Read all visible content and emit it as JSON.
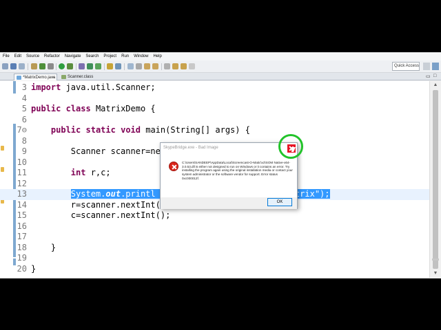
{
  "menu": [
    "File",
    "Edit",
    "Source",
    "Refactor",
    "Navigate",
    "Search",
    "Project",
    "Run",
    "Window",
    "Help"
  ],
  "toolbar": {
    "quick_access_label": "Quick Access"
  },
  "tabs": [
    {
      "label": "*MatrixDemo.java",
      "active": true
    },
    {
      "label": "Scanner.class",
      "active": false
    }
  ],
  "editor": {
    "lines": [
      {
        "n": "3",
        "segments": [
          {
            "t": "import",
            "c": "kw"
          },
          {
            "t": " java.util.Scanner;"
          }
        ]
      },
      {
        "n": "4",
        "segments": []
      },
      {
        "n": "5",
        "segments": [
          {
            "t": "public",
            "c": "kw"
          },
          {
            "t": " "
          },
          {
            "t": "class",
            "c": "kw"
          },
          {
            "t": " MatrixDemo {"
          }
        ]
      },
      {
        "n": "6",
        "segments": []
      },
      {
        "n": "7⊖",
        "segments": [
          {
            "t": "    "
          },
          {
            "t": "public",
            "c": "kw"
          },
          {
            "t": " "
          },
          {
            "t": "static",
            "c": "kw"
          },
          {
            "t": " "
          },
          {
            "t": "void",
            "c": "kw"
          },
          {
            "t": " main(String[] args) {"
          }
        ]
      },
      {
        "n": "8",
        "segments": []
      },
      {
        "n": "9",
        "segments": [
          {
            "t": "        Scanner scanner=new"
          }
        ]
      },
      {
        "n": "10",
        "segments": []
      },
      {
        "n": "11",
        "segments": [
          {
            "t": "        "
          },
          {
            "t": "int",
            "c": "kw"
          },
          {
            "t": " r,c;"
          }
        ]
      },
      {
        "n": "12",
        "segments": []
      },
      {
        "n": "13",
        "segments": [
          {
            "t": "        "
          },
          {
            "t": "System.",
            "c": "sel"
          },
          {
            "t": "out",
            "c": "sel it"
          },
          {
            "t": ".printl",
            "c": "sel"
          },
          {
            "t": "                        ",
            "c": "sel"
          },
          {
            "t": "n matrix\");",
            "c": "sel"
          }
        ]
      },
      {
        "n": "14",
        "segments": [
          {
            "t": "        r=scanner.nextInt("
          }
        ]
      },
      {
        "n": "15",
        "segments": [
          {
            "t": "        c=scanner.nextInt();"
          }
        ]
      },
      {
        "n": "16",
        "segments": []
      },
      {
        "n": "17",
        "segments": []
      },
      {
        "n": "18",
        "segments": [
          {
            "t": "    }"
          }
        ]
      },
      {
        "n": "19",
        "segments": []
      },
      {
        "n": "20",
        "segments": [
          {
            "t": "}"
          }
        ]
      }
    ]
  },
  "dialog": {
    "title": "SkypeBridge.exe - Bad Image",
    "message": "C:\\Users\\SANDEEP\\AppData\\Local\\Screencast-O-Matic\\v2\\SOM Native-x64-3.0.53.dll is either not designed to run on Windows or it contains an error. Try installing the program again using the original installation media or contact your system administrator or the software vendor for support. Error status 0xc000012f.",
    "ok_label": "OK"
  },
  "colors": {
    "keyword": "#7f0055",
    "selection": "#3399ff",
    "current_line": "#e8f2fe",
    "error_red": "#d9261c",
    "highlight_circle": "#22c32a"
  }
}
